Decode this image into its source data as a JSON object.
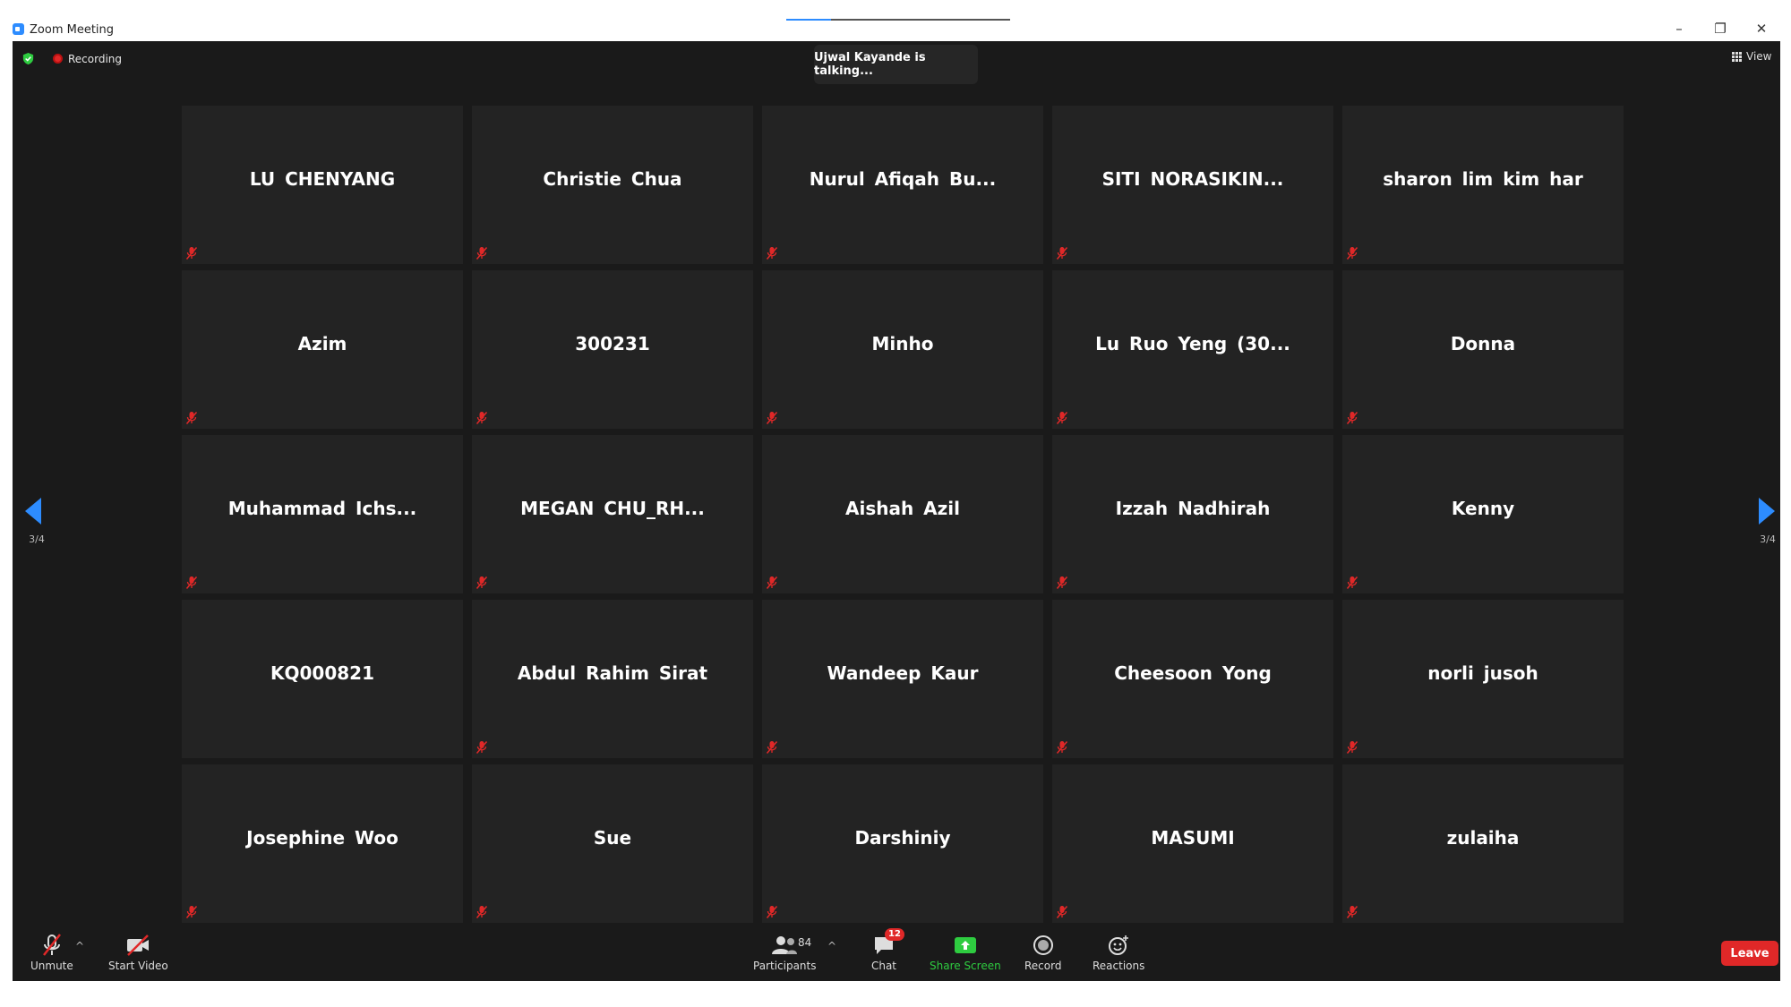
{
  "window": {
    "title": "Zoom Meeting",
    "loading_progress": 0.2,
    "controls": {
      "minimize": "–",
      "maximize": "❐",
      "close": "✕"
    }
  },
  "meeting": {
    "recording_label": "Recording",
    "talking_notice": "Ujwal Kayande is talking...",
    "view_label": "View",
    "page_indicator": "3/4",
    "colors": {
      "accent": "#2d8cff",
      "muted": "#e02828",
      "share": "#2ecc40",
      "background": "#1a1a1a",
      "tile": "#232323"
    }
  },
  "participants": [
    {
      "name": "LU CHENYANG",
      "muted": true
    },
    {
      "name": "Christie Chua",
      "muted": true
    },
    {
      "name": "Nurul Afiqah Bu...",
      "muted": true
    },
    {
      "name": "SITI NORASIKIN...",
      "muted": true
    },
    {
      "name": "sharon lim kim har",
      "muted": true
    },
    {
      "name": "Azim",
      "muted": true
    },
    {
      "name": "300231",
      "muted": true
    },
    {
      "name": "Minho",
      "muted": true
    },
    {
      "name": "Lu Ruo Yeng (30...",
      "muted": true
    },
    {
      "name": "Donna",
      "muted": true
    },
    {
      "name": "Muhammad Ichs...",
      "muted": true
    },
    {
      "name": "MEGAN CHU_RH...",
      "muted": true
    },
    {
      "name": "Aishah Azil",
      "muted": true
    },
    {
      "name": "Izzah Nadhirah",
      "muted": true
    },
    {
      "name": "Kenny",
      "muted": true
    },
    {
      "name": "KQ000821",
      "muted": false
    },
    {
      "name": "Abdul Rahim Sirat",
      "muted": true
    },
    {
      "name": "Wandeep Kaur",
      "muted": true
    },
    {
      "name": "Cheesoon Yong",
      "muted": true
    },
    {
      "name": "norli jusoh",
      "muted": true
    },
    {
      "name": "Josephine Woo",
      "muted": true
    },
    {
      "name": "Sue",
      "muted": true
    },
    {
      "name": "Darshiniy",
      "muted": true
    },
    {
      "name": "MASUMI",
      "muted": true
    },
    {
      "name": "zulaiha",
      "muted": true
    }
  ],
  "toolbar": {
    "unmute_label": "Unmute",
    "start_video_label": "Start Video",
    "participants_label": "Participants",
    "participants_count": "84",
    "chat_label": "Chat",
    "chat_badge": "12",
    "share_label": "Share Screen",
    "record_label": "Record",
    "reactions_label": "Reactions",
    "leave_label": "Leave",
    "caret": "^"
  }
}
